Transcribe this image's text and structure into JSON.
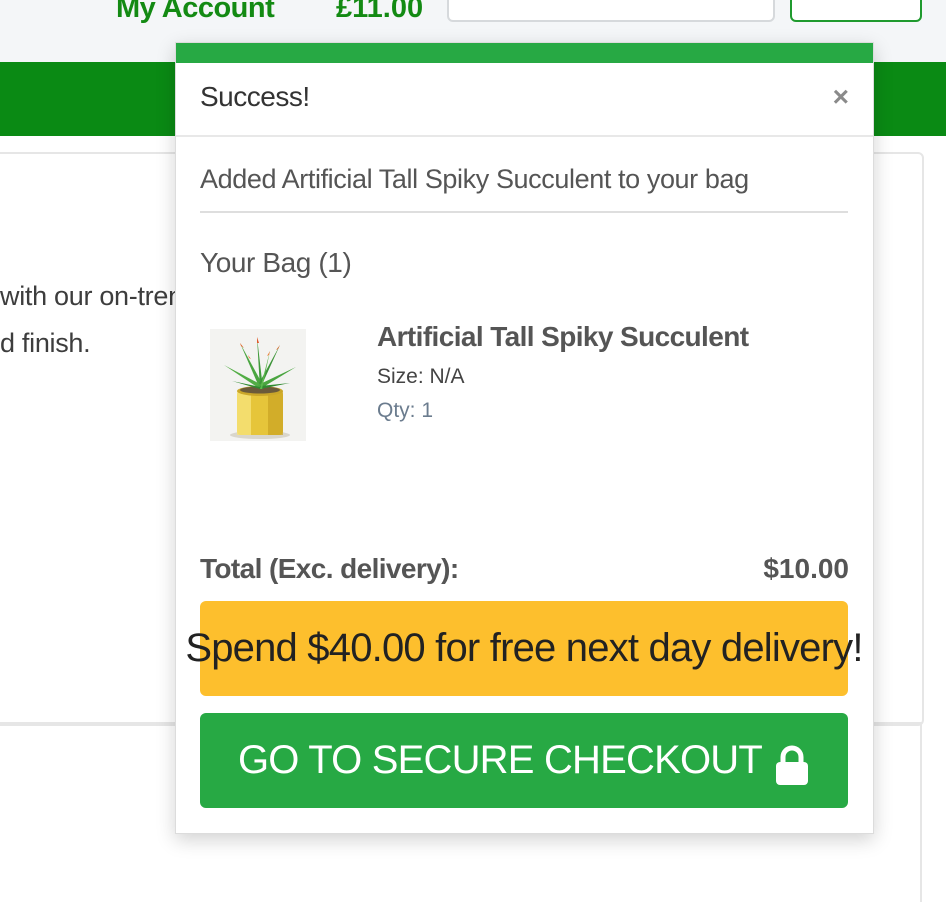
{
  "header": {
    "my_account": "My Account",
    "balance": "£11.00"
  },
  "background": {
    "line1": "with our on-tren",
    "line2": "d finish."
  },
  "modal": {
    "title": "Success!",
    "close_symbol": "×",
    "added_message": "Added Artificial Tall Spiky Succulent to your bag",
    "bag_heading": "Your Bag (1)",
    "item": {
      "name": "Artificial Tall Spiky Succulent",
      "size": "Size: N/A",
      "qty": "Qty: 1",
      "image_icon": "succulent-product-image"
    },
    "total_label": "Total (Exc. delivery):",
    "total_value": "$10.00",
    "promo_text": "Spend $40.00 for free next day delivery!",
    "checkout_label": "GO TO SECURE CHECKOUT",
    "checkout_icon": "lock-icon"
  },
  "colors": {
    "brand_green": "#27a944",
    "dark_green": "#0a8a14",
    "promo_yellow": "#fdbf2d"
  }
}
